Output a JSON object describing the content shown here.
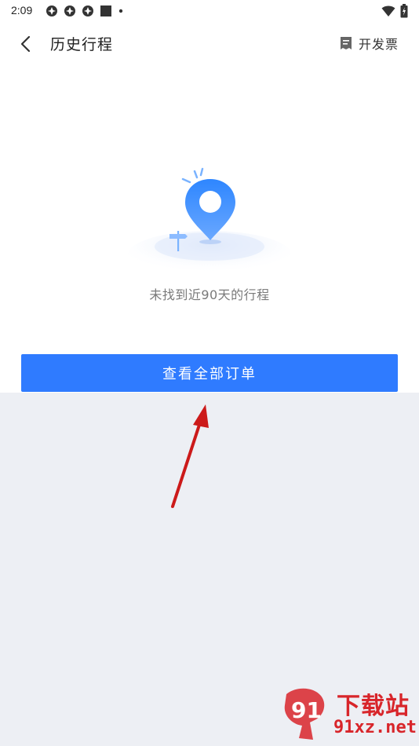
{
  "status_bar": {
    "time": "2:09",
    "icons_left": [
      "notification-icon",
      "notification-icon",
      "notification-icon",
      "stop-icon",
      "dot-icon"
    ],
    "icons_right": [
      "wifi-icon",
      "battery-icon"
    ]
  },
  "app_bar": {
    "title": "历史行程",
    "back_icon": "chevron-left-icon",
    "invoice_icon": "receipt-icon",
    "invoice_label": "开发票"
  },
  "empty_state": {
    "illustration": "location-pin-icon",
    "message": "未找到近90天的行程"
  },
  "actions": {
    "view_all_orders": "查看全部订单"
  },
  "watermark": {
    "logo": "91-logo",
    "title": "下载站",
    "url": "91xz.net"
  },
  "colors": {
    "primary": "#2f7bff",
    "background_grey": "#edeff4",
    "watermark_red": "#d8252a",
    "annotation_arrow": "#cc1a1a"
  }
}
